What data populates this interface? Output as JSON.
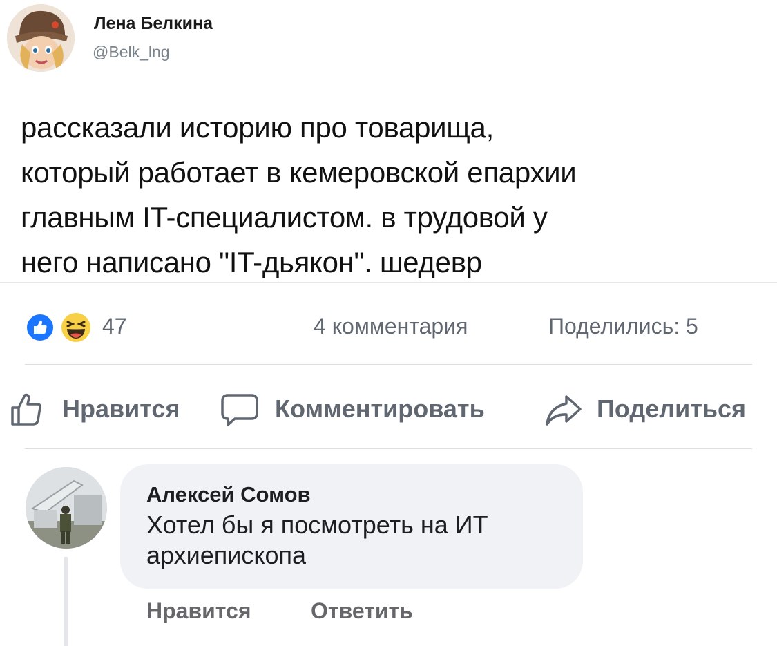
{
  "tweet": {
    "author_name": "Лена Белкина",
    "handle": "@Belk_lng",
    "lines": [
      "рассказали историю про товарища,",
      "который работает в кемеровской епархии",
      "главным IT-специалистом. в трудовой у",
      "него написано \"IT-дьякон\". шедевр"
    ]
  },
  "stats": {
    "reactions": [
      "like-icon",
      "haha-icon"
    ],
    "reaction_count": "47",
    "comments": "4 комментария",
    "shares": "Поделились: 5"
  },
  "actions": {
    "like": "Нравится",
    "comment": "Комментировать",
    "share": "Поделиться"
  },
  "comment": {
    "author": "Алексей Сомов",
    "lines": [
      "Хотел бы я посмотреть на ИТ",
      "архиепископа"
    ],
    "like": "Нравится",
    "reply": "Ответить"
  },
  "colors": {
    "text": "#1c1e21",
    "muted": "#606770",
    "handle": "#7b838b",
    "like_blue": "#1a75ff",
    "haha_yellow": "#f7d048",
    "bubble_bg": "#f0f2f5",
    "divider": "#dadde1"
  }
}
